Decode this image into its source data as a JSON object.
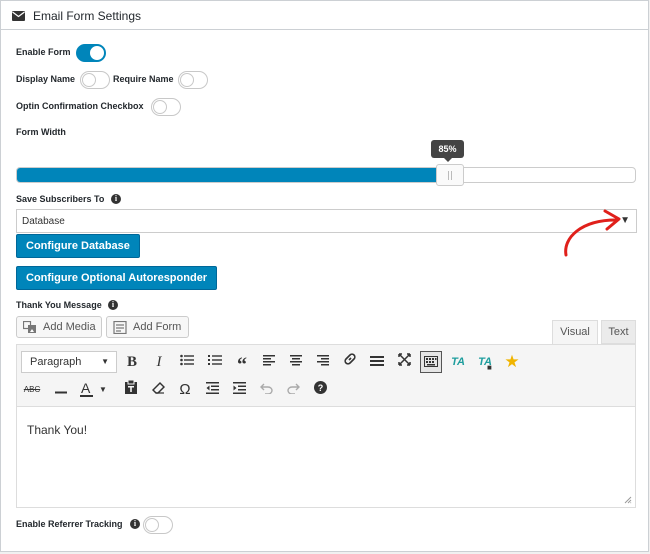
{
  "header": {
    "icon": "envelope-icon",
    "title": "Email Form Settings"
  },
  "toggles": {
    "enable_form": {
      "label": "Enable Form",
      "on": true
    },
    "display_name": {
      "label": "Display Name",
      "on": false
    },
    "require_name": {
      "label": "Require Name",
      "on": false
    },
    "optin": {
      "label": "Optin Confirmation Checkbox",
      "on": false
    }
  },
  "form_width": {
    "label": "Form Width",
    "value_label": "85%",
    "value": 0.7
  },
  "save_subscribers": {
    "label": "Save Subscribers To",
    "selected": "Database",
    "arrow": "▼"
  },
  "buttons": {
    "configure_database": "Configure Database",
    "configure_autoresponder": "Configure Optional Autoresponder",
    "add_media": "Add Media",
    "add_form": "Add Form"
  },
  "thank_you": {
    "label": "Thank You Message"
  },
  "editor": {
    "tabs": [
      "Visual",
      "Text"
    ],
    "format_select": "Paragraph",
    "content": "Thank You!"
  },
  "referrer": {
    "label": "Enable Referrer Tracking",
    "on": false
  },
  "colors": {
    "accent": "#0085ba",
    "annotation": "#e0201b"
  }
}
